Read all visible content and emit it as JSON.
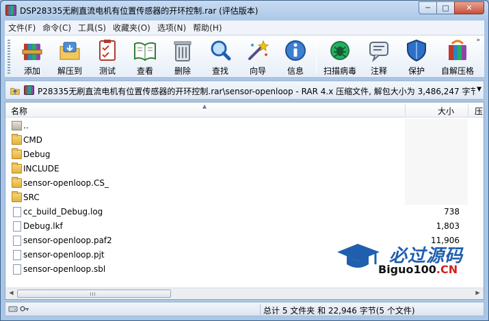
{
  "window": {
    "title": "DSP28335无刷直流电机有位置传感器的开环控制.rar (评估版本)",
    "buttons": {
      "minimize": "─",
      "maximize": "□",
      "close": "✕"
    }
  },
  "menu": [
    "文件(F)",
    "命令(C)",
    "工具(S)",
    "收藏夹(O)",
    "选项(N)",
    "帮助(H)"
  ],
  "toolbar": [
    {
      "label": "添加",
      "icon": "add-archive-icon"
    },
    {
      "label": "解压到",
      "icon": "extract-to-icon"
    },
    {
      "label": "测试",
      "icon": "test-icon"
    },
    {
      "label": "查看",
      "icon": "view-icon"
    },
    {
      "label": "删除",
      "icon": "delete-icon"
    },
    {
      "label": "查找",
      "icon": "find-icon"
    },
    {
      "label": "向导",
      "icon": "wizard-icon"
    },
    {
      "label": "信息",
      "icon": "info-icon"
    },
    {
      "label": "扫描病毒",
      "icon": "virus-scan-icon"
    },
    {
      "label": "注释",
      "icon": "comment-icon"
    },
    {
      "label": "保护",
      "icon": "protect-icon"
    },
    {
      "label": "自解压格",
      "icon": "sfx-icon"
    }
  ],
  "pathbar": {
    "text": "P28335无刷直流电机有位置传感器的开环控制.rar\\sensor-openloop - RAR 4.x 压缩文件, 解包大小为 3,486,247 字节"
  },
  "columns": {
    "name": "名称",
    "size": "大小",
    "packed": "压"
  },
  "files": [
    {
      "name": "..",
      "type": "updir",
      "size": ""
    },
    {
      "name": "CMD",
      "type": "folder",
      "size": ""
    },
    {
      "name": "Debug",
      "type": "folder",
      "size": ""
    },
    {
      "name": "INCLUDE",
      "type": "folder",
      "size": ""
    },
    {
      "name": "sensor-openloop.CS_",
      "type": "folder",
      "size": ""
    },
    {
      "name": "SRC",
      "type": "folder",
      "size": ""
    },
    {
      "name": "cc_build_Debug.log",
      "type": "file",
      "size": "738"
    },
    {
      "name": "Debug.lkf",
      "type": "file",
      "size": "1,803"
    },
    {
      "name": "sensor-openloop.paf2",
      "type": "file",
      "size": "11,906"
    },
    {
      "name": "sensor-openloop.pjt",
      "type": "file",
      "size": ""
    },
    {
      "name": "sensor-openloop.sbl",
      "type": "file",
      "size": ""
    }
  ],
  "watermark": {
    "cn": "必过源码",
    "en_black": "Biguo100",
    "en_red": ".CN"
  },
  "status": {
    "text": "总计 5 文件夹 和 22,946 字节(5 个文件)"
  },
  "colors": {
    "accent": "#1f5fae",
    "title_bg": "#c8dcf2"
  }
}
